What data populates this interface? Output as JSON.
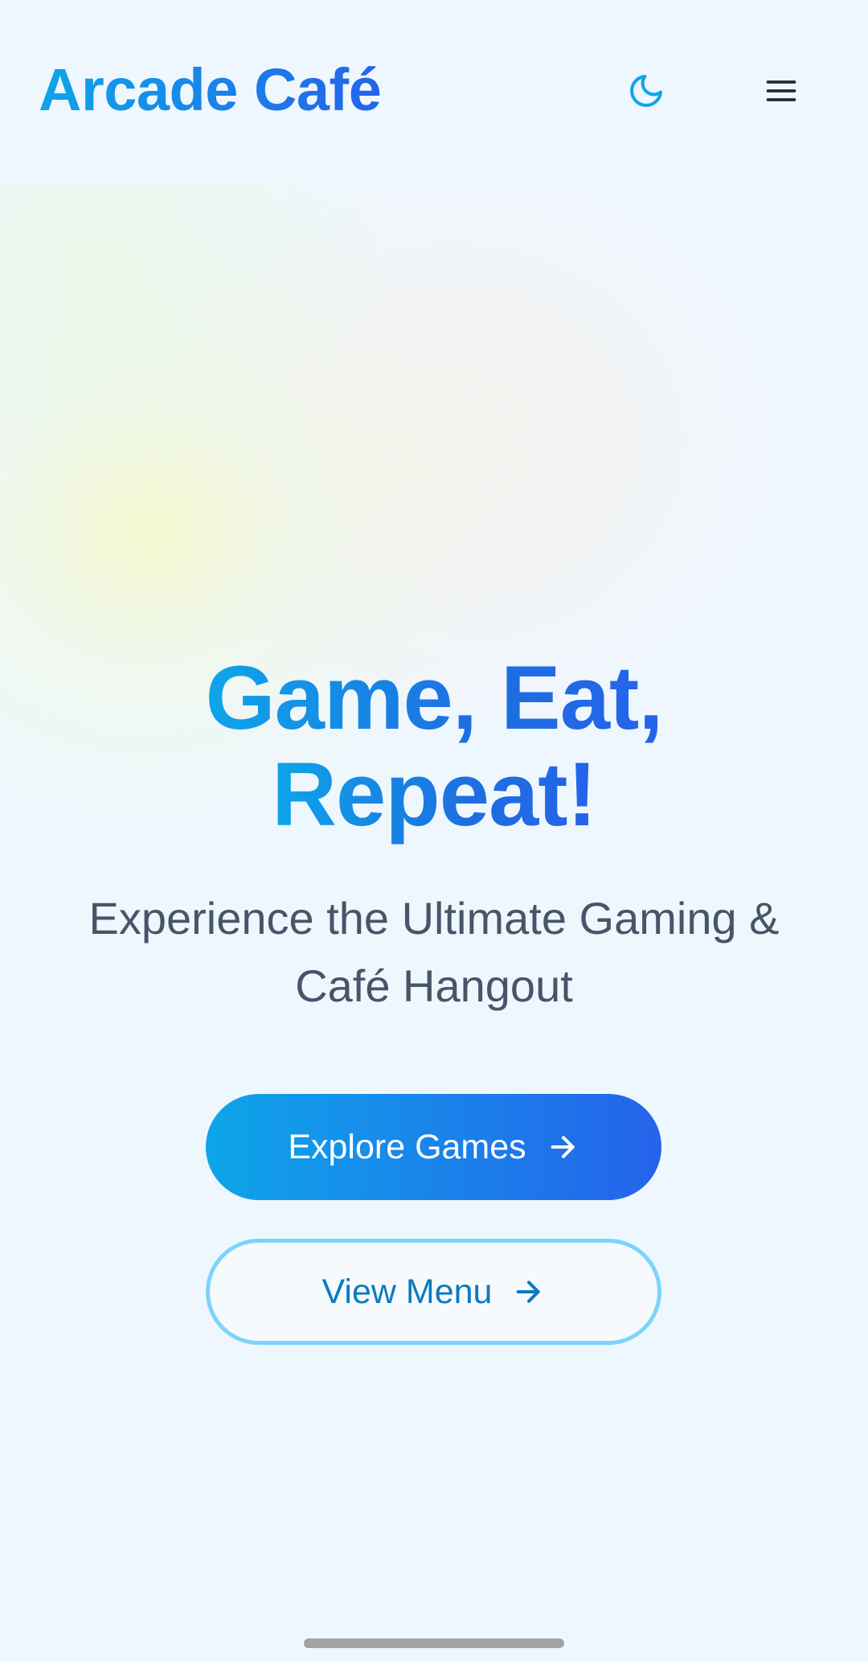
{
  "header": {
    "logo": "Arcade Café",
    "theme_toggle_icon": "moon-icon",
    "menu_icon": "hamburger-menu-icon"
  },
  "hero": {
    "headline_line1": "Game, Eat,",
    "headline_line2": "Repeat!",
    "subtitle_line1": "Experience the Ultimate Gaming &",
    "subtitle_line2": "Café Hangout",
    "primary_button": {
      "label": "Explore Games",
      "icon": "arrow-right-icon"
    },
    "secondary_button": {
      "label": "View Menu",
      "icon": "arrow-right-icon"
    }
  },
  "colors": {
    "accent_start": "#0ea5e9",
    "accent_end": "#2563eb",
    "background": "#eff7fe",
    "text_muted": "#475569",
    "outline": "#7dd3fc"
  }
}
